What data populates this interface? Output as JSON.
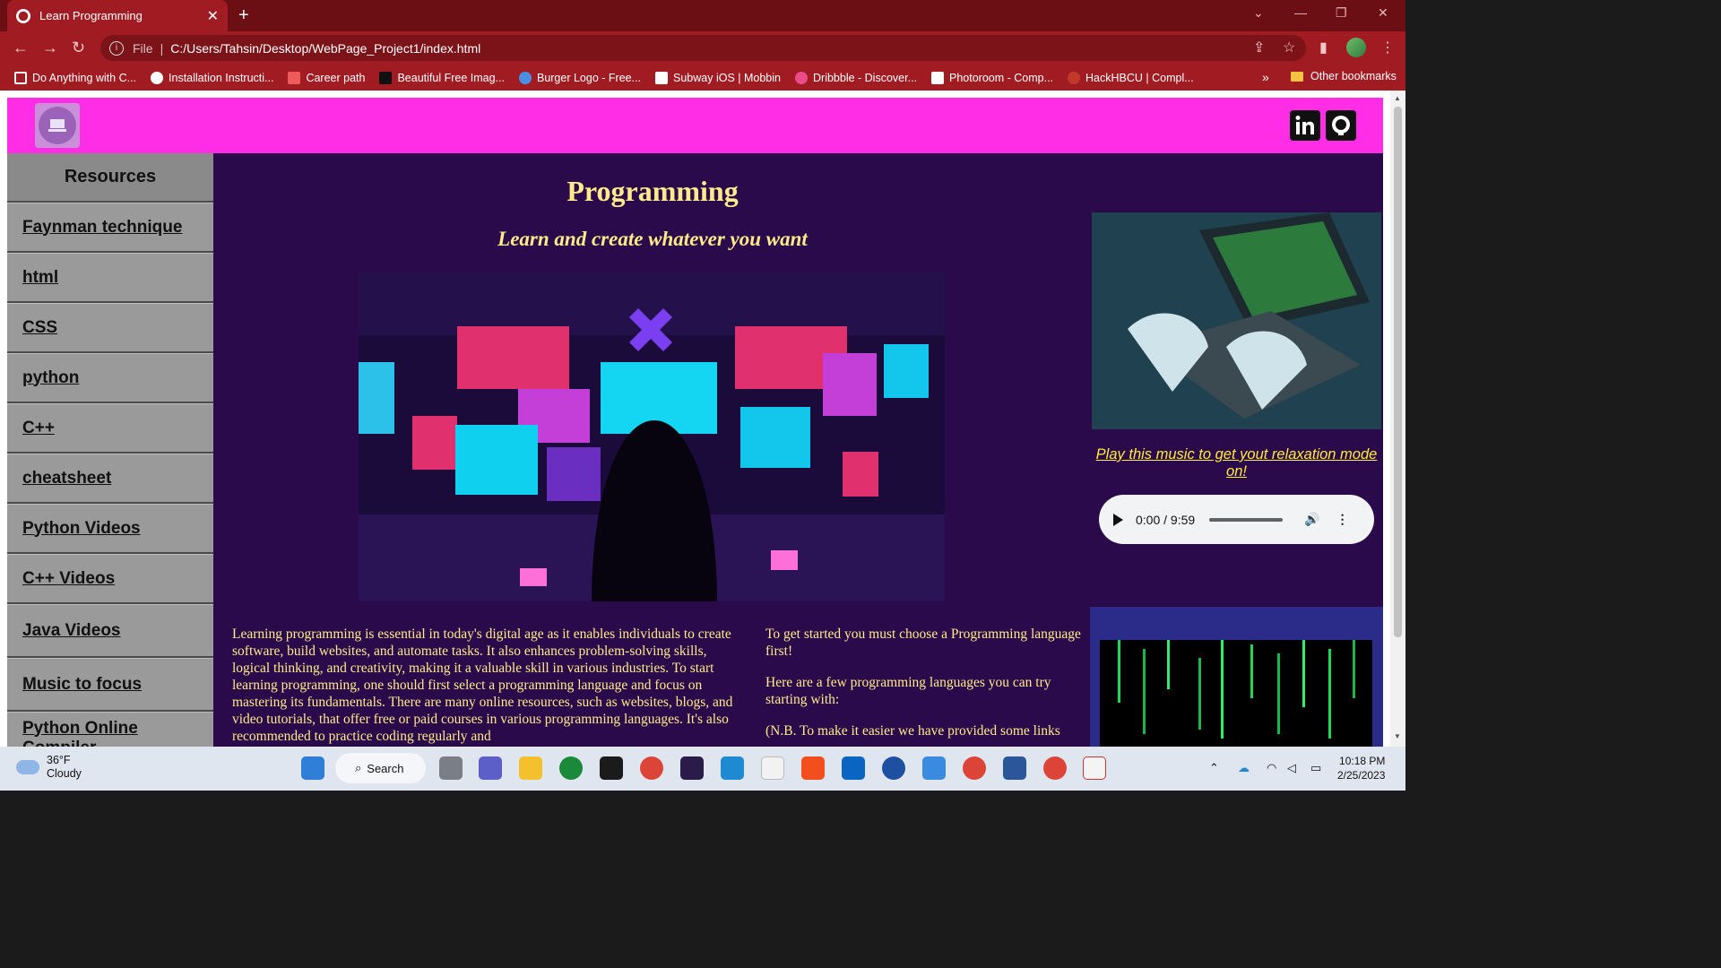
{
  "browser": {
    "tab_title": "Learn Programming",
    "tab_close": "✕",
    "new_tab": "+",
    "file_label": "File",
    "url": "C:/Users/Tahsin/Desktop/WebPage_Project1/index.html",
    "bookmarks": [
      {
        "label": "Do Anything with C...",
        "color": "#ffffff"
      },
      {
        "label": "Installation Instructi...",
        "color": "#ffffff"
      },
      {
        "label": "Career path",
        "color": "#f05a5a"
      },
      {
        "label": "Beautiful Free Imag...",
        "color": "#111111"
      },
      {
        "label": "Burger Logo - Free...",
        "color": "#4a90e2"
      },
      {
        "label": "Subway iOS | Mobbin",
        "color": "#ffffff"
      },
      {
        "label": "Dribbble - Discover...",
        "color": "#ea4c89"
      },
      {
        "label": "Photoroom - Comp...",
        "color": "#ffffff"
      },
      {
        "label": "HackHBCU | Compl...",
        "color": "#c0392b"
      }
    ],
    "bookmarks_more": "»",
    "other_bookmarks": "Other bookmarks"
  },
  "page": {
    "sidebar": {
      "heading": "Resources",
      "items": [
        "Faynman technique",
        "html",
        "CSS",
        "python",
        "C++",
        "cheatsheet",
        "Python Videos",
        "C++ Videos",
        "Java Videos",
        "Music to focus",
        "Python Online Compiler"
      ]
    },
    "title": "Programming",
    "subtitle": "Learn and create whatever you want",
    "left_paragraph": "Learning programming is essential in today's digital age as it enables individuals to create software, build websites, and automate tasks. It also enhances problem-solving skills, logical thinking, and creativity, making it a valuable skill in various industries. To start learning programming, one should first select a programming language and focus on mastering its fundamentals. There are many online resources, such as websites, blogs, and video tutorials, that offer free or paid courses in various programming languages. It's also recommended to practice coding regularly and",
    "right_paragraphs": [
      "To get started you must choose a Programming language first!",
      "Here are a few programming languages you can try starting with:",
      "(N.B. To make it easier we have provided some links"
    ],
    "music_link": "Play this music to get yout relaxation mode on!",
    "audio": {
      "time": "0:00 / 9:59",
      "progress": 0
    },
    "colors": {
      "header": "#ff2ee6",
      "background": "#2a0a4a",
      "accent_text": "#ffeb8a"
    }
  },
  "taskbar": {
    "temperature": "36°F",
    "condition": "Cloudy",
    "search": "Search",
    "time": "10:18 PM",
    "date": "2/25/2023"
  }
}
